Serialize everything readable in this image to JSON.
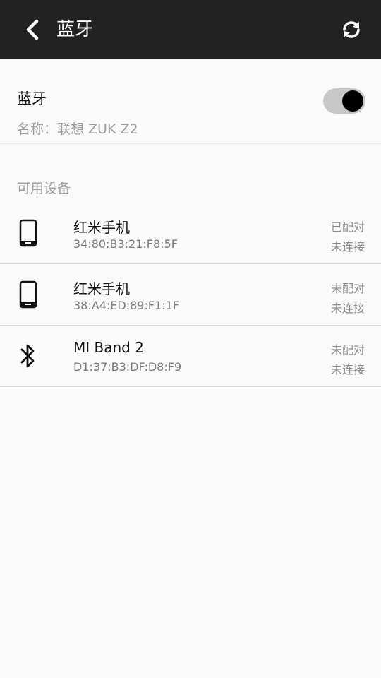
{
  "topbar": {
    "title": "蓝牙",
    "back_icon": "chevron-left-icon",
    "refresh_icon": "refresh-icon",
    "background": "#222222"
  },
  "bluetooth": {
    "label": "蓝牙",
    "name_line": "名称：联想 ZUK Z2",
    "enabled": true
  },
  "available": {
    "header": "可用设备",
    "devices": [
      {
        "icon": "phone-icon",
        "name": "红米手机",
        "mac": "34:80:B3:21:F8:5F",
        "pair_status": "已配对",
        "conn_status": "未连接"
      },
      {
        "icon": "phone-icon",
        "name": "红米手机",
        "mac": "38:A4:ED:89:F1:1F",
        "pair_status": "未配对",
        "conn_status": "未连接"
      },
      {
        "icon": "bluetooth-icon",
        "name": "MI Band 2",
        "mac": "D1:37:B3:DF:D8:F9",
        "pair_status": "未配对",
        "conn_status": "未连接"
      }
    ]
  }
}
